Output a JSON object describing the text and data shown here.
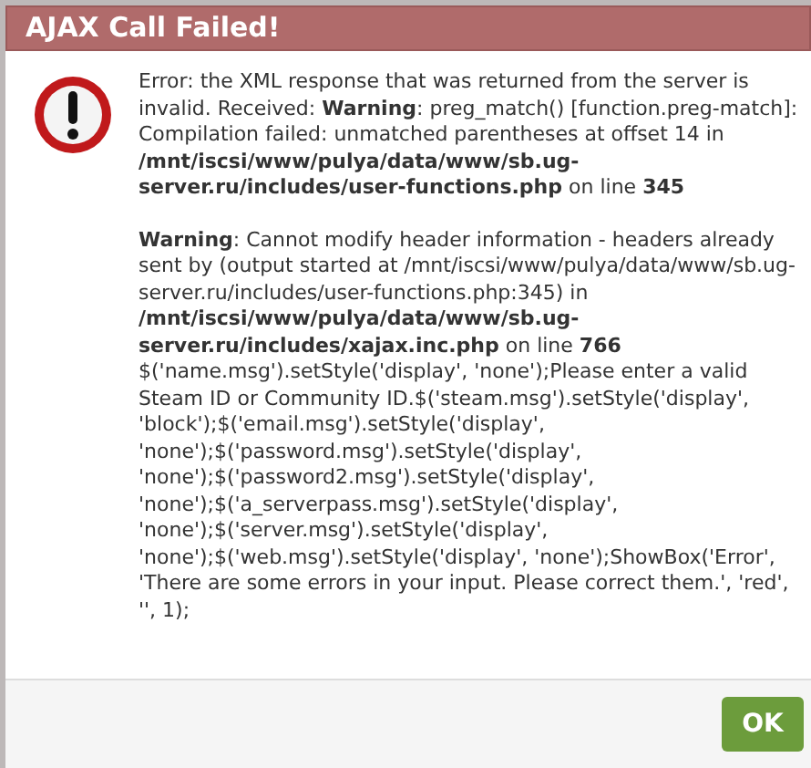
{
  "dialog": {
    "title": "AJAX Call Failed!",
    "paragraphs": [
      "Error: the XML response that was returned from the server is invalid. Received: **Warning**: preg_match() [function.preg-match]: Compilation failed: unmatched parentheses at offset 14 in **/mnt/iscsi/www/pulya/data/www/sb.ug-server.ru/includes/user-functions.php** on line **345**",
      "**Warning**: Cannot modify header information - headers already sent by (output started at /mnt/iscsi/www/pulya/data/www/sb.ug-server.ru/includes/user-functions.php:345) in **/mnt/iscsi/www/pulya/data/www/sb.ug-server.ru/includes/xajax.inc.php** on line **766** $('name.msg').setStyle('display', 'none');Please enter a valid Steam ID or Community ID.$('steam.msg').setStyle('display', 'block');$('email.msg').setStyle('display', 'none');$('password.msg').setStyle('display', 'none');$('password2.msg').setStyle('display', 'none');$('a_serverpass.msg').setStyle('display', 'none');$('server.msg').setStyle('display', 'none');$('web.msg').setStyle('display', 'none');ShowBox('Error', 'There are some errors in your input. Please correct them.', 'red', '', 1);"
    ],
    "buttons": [
      "OK"
    ]
  }
}
